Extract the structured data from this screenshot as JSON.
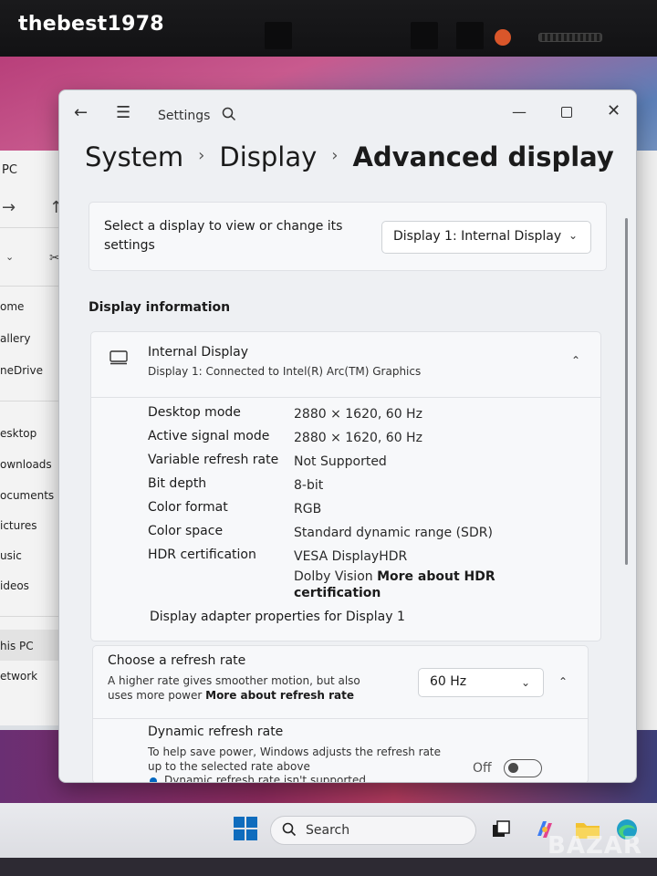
{
  "photo": {
    "watermark_top": "thebest1978",
    "watermark_bottom": "BAZAR"
  },
  "explorer": {
    "title": "PC",
    "nav_items": [
      "ome",
      "allery",
      "neDrive",
      "esktop",
      "ownloads",
      "ocuments",
      "ictures",
      "usic",
      "ideos",
      "his PC",
      "etwork"
    ]
  },
  "window": {
    "title": "Settings",
    "controls": {
      "minimize": "—",
      "close": "✕"
    }
  },
  "breadcrumb": {
    "items": [
      "System",
      "Display"
    ],
    "current": "Advanced display",
    "separator": "›"
  },
  "display_select": {
    "label": "Select a display to view or change its settings",
    "selected": "Display 1: Internal Display"
  },
  "display_info": {
    "section_title": "Display information",
    "name": "Internal Display",
    "subtitle": "Display 1: Connected to Intel(R) Arc(TM) Graphics",
    "rows": [
      {
        "label": "Desktop mode",
        "value": "2880 × 1620, 60 Hz"
      },
      {
        "label": "Active signal mode",
        "value": "2880 × 1620, 60 Hz"
      },
      {
        "label": "Variable refresh rate",
        "value": "Not Supported"
      },
      {
        "label": "Bit depth",
        "value": "8-bit"
      },
      {
        "label": "Color format",
        "value": "RGB"
      },
      {
        "label": "Color space",
        "value": "Standard dynamic range (SDR)"
      },
      {
        "label": "HDR certification",
        "value": "VESA DisplayHDR"
      }
    ],
    "hdr_extra": "Dolby Vision",
    "hdr_link": "More about HDR",
    "hdr_link_2": "certification",
    "adapter_link": "Display adapter properties for Display 1"
  },
  "refresh_rate": {
    "title": "Choose a refresh rate",
    "description": "A higher rate gives smoother motion, but also uses more power",
    "link": "More about refresh rate",
    "selected": "60 Hz"
  },
  "dynamic_refresh": {
    "title": "Dynamic refresh rate",
    "description": "To help save power, Windows adjusts the refresh rate up to the selected rate above",
    "note": "Dynamic refresh rate isn't supported",
    "toggle_label": "Off",
    "toggle_on": false
  },
  "taskbar": {
    "search_placeholder": "Search"
  },
  "colors": {
    "accent": "#0067c0",
    "window_bg": "#eef0f3",
    "card_bg": "#f7f8fa"
  }
}
